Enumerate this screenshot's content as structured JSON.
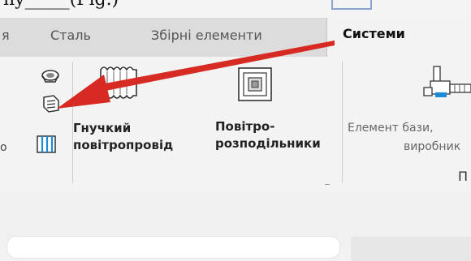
{
  "top_fragment": "ny_____(Fig.)",
  "tabs": [
    {
      "label": "я"
    },
    {
      "label": "Сталь"
    },
    {
      "label": "Збірні елементи"
    },
    {
      "label": "Системи"
    }
  ],
  "ribbon": {
    "flex_duct_label_1": "Гнучкий",
    "flex_duct_label_2": "повітропровід",
    "air_terminal_label_1": "Повітро-",
    "air_terminal_label_2": "розподільники",
    "base_element_label_1": "Елемент бази,",
    "base_element_label_2": "виробник",
    "panel_fragment": "П",
    "left_fragment": "о"
  },
  "colors": {
    "annotation_arrow": "#d62a22",
    "tab_bar": "#dcdcdc",
    "ribbon_bg": "#f3f3f3"
  },
  "icons": [
    "duct-fitting-icon",
    "duct-accessory-icon",
    "flex-pipe-icon",
    "flex-duct-icon",
    "air-terminal-icon",
    "mechanical-equipment-icon"
  ]
}
